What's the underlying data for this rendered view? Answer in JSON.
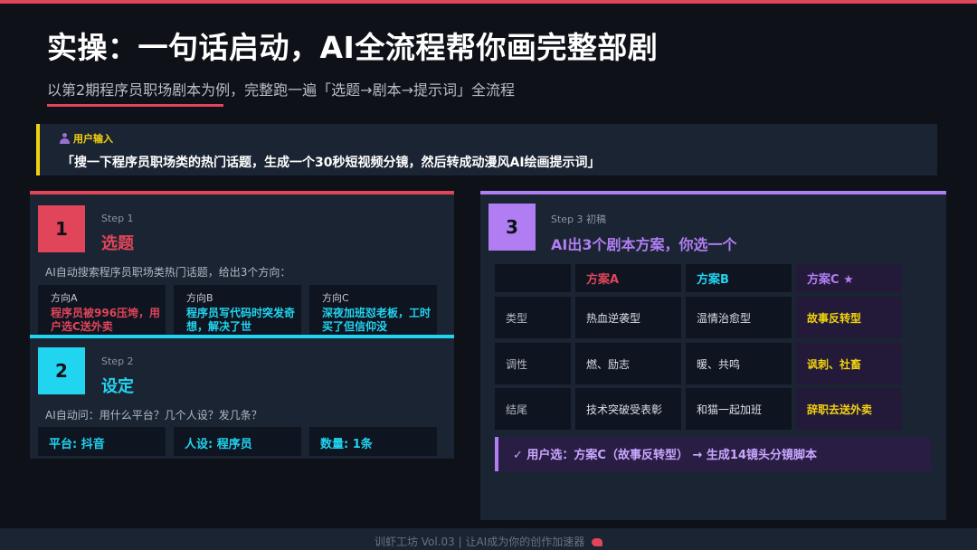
{
  "title": "实操：一句话启动，AI全流程帮你画完整部剧",
  "subtitle": "以第2期程序员职场剧本为例，完整跑一遍「选题→剧本→提示词」全流程",
  "user_input": {
    "label": "用户输入",
    "text": "「搜一下程序员职场类的热门话题，生成一个30秒短视频分镜，然后转成动漫风AI绘画提示词」"
  },
  "step1": {
    "number": "1",
    "step_label": "Step 1",
    "title": "选题",
    "description": "AI自动搜索程序员职场类热门话题，给出3个方向：",
    "directions": [
      {
        "label": "方向A",
        "text": "程序员被996压垮，用户选C送外卖"
      },
      {
        "label": "方向B",
        "text": "程序员写代码时突发奇想，解决了世"
      },
      {
        "label": "方向C",
        "text": "深夜加班怼老板，工时买了但信仰没"
      }
    ]
  },
  "step2": {
    "number": "2",
    "step_label": "Step 2",
    "title": "设定",
    "description": "AI自动问：用什么平台？几个人设？发几条？",
    "settings": [
      "平台: 抖音",
      "人设: 程序员",
      "数量: 1条"
    ]
  },
  "step3": {
    "number": "3",
    "step_label": "Step 3  初稿",
    "title": "AI出3个剧本方案，你选一个",
    "columns": [
      "方案A",
      "方案B",
      "方案C ★"
    ],
    "rows": [
      {
        "label": "类型",
        "values": [
          "热血逆袭型",
          "温情治愈型",
          "故事反转型"
        ]
      },
      {
        "label": "调性",
        "values": [
          "燃、励志",
          "暖、共鸣",
          "讽刺、社畜"
        ]
      },
      {
        "label": "结尾",
        "values": [
          "技术突破受表彰",
          "和猫一起加班",
          "辞职去送外卖"
        ]
      }
    ],
    "choice": "✓ 用户选：方案C（故事反转型） → 生成14镜头分镜脚本"
  },
  "footer": "训虾工坊 Vol.03  |  让AI成为你的创作加速器",
  "colors": {
    "accent_red": "#e0455a",
    "accent_cyan": "#21d4f0",
    "accent_purple": "#b07ef2",
    "accent_yellow": "#f2d20f",
    "background": "#0e1117",
    "card": "#1b2433"
  },
  "icons": [
    "person-icon",
    "shrimp-icon"
  ]
}
